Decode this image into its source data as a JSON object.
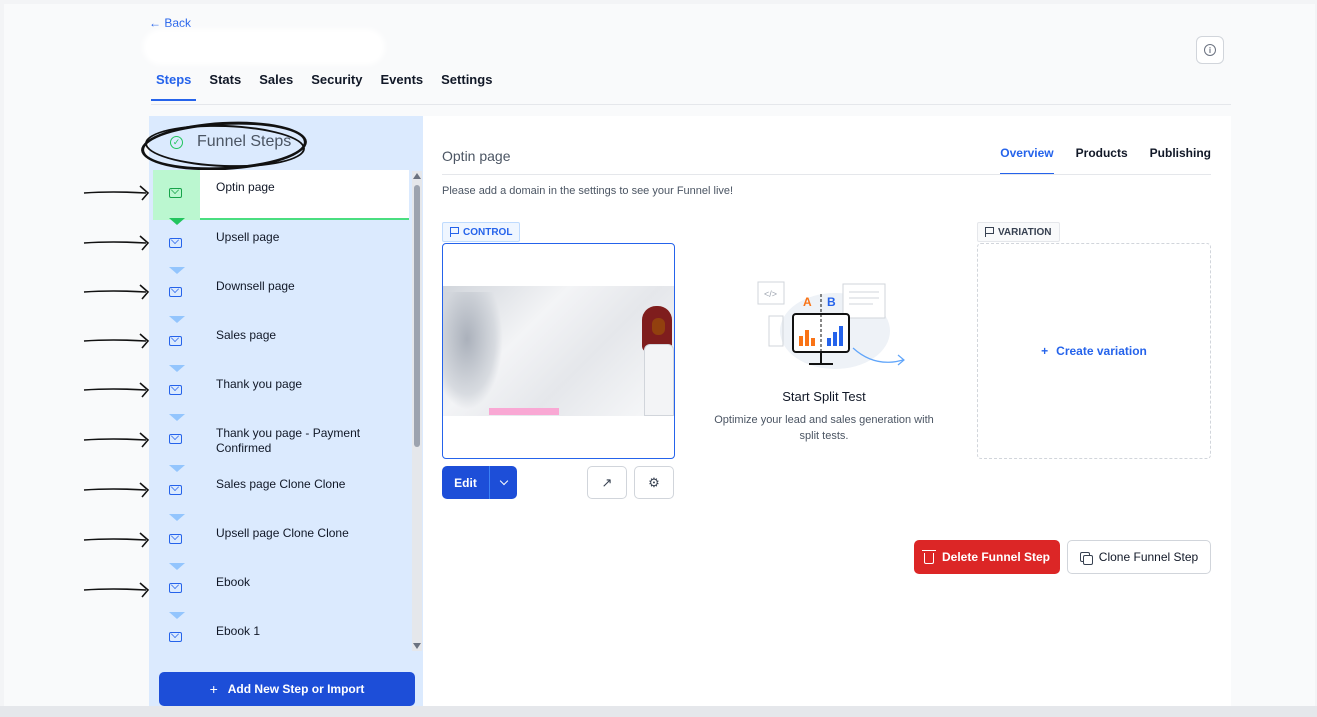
{
  "nav": {
    "back_label": "← Back"
  },
  "tabs": [
    "Steps",
    "Stats",
    "Sales",
    "Security",
    "Events",
    "Settings"
  ],
  "sidebar": {
    "title": "Funnel Steps",
    "steps": [
      "Optin page",
      "Upsell page",
      "Downsell page",
      "Sales page",
      "Thank you page",
      "Thank you page - Payment Confirmed",
      "Sales page Clone Clone",
      "Upsell page Clone Clone",
      "Ebook",
      "Ebook 1"
    ],
    "active_index": 0,
    "add_button_label": "Add New Step or Import",
    "add_button_icon": "+"
  },
  "main": {
    "title": "Optin page",
    "tabs": [
      "Overview",
      "Products",
      "Publishing"
    ],
    "notice": "Please add a domain in the settings to see your Funnel live!",
    "control_label": "CONTROL",
    "variation_label": "VARIATION",
    "edit_label": "Edit",
    "split_test_title": "Start Split Test",
    "split_test_desc": "Optimize your lead and sales generation with split tests.",
    "create_variation_label": "Create variation",
    "create_variation_icon": "+",
    "delete_label": "Delete Funnel Step",
    "clone_label": "Clone Funnel Step",
    "illus_a": "A",
    "illus_b": "B",
    "external_link_icon": "↗",
    "gear_icon": "⚙",
    "info_icon": "i"
  },
  "colors": {
    "accent": "#2563eb",
    "danger": "#dc2626",
    "sidebar_bg": "#dbeafe",
    "active_green": "#4ade80"
  }
}
